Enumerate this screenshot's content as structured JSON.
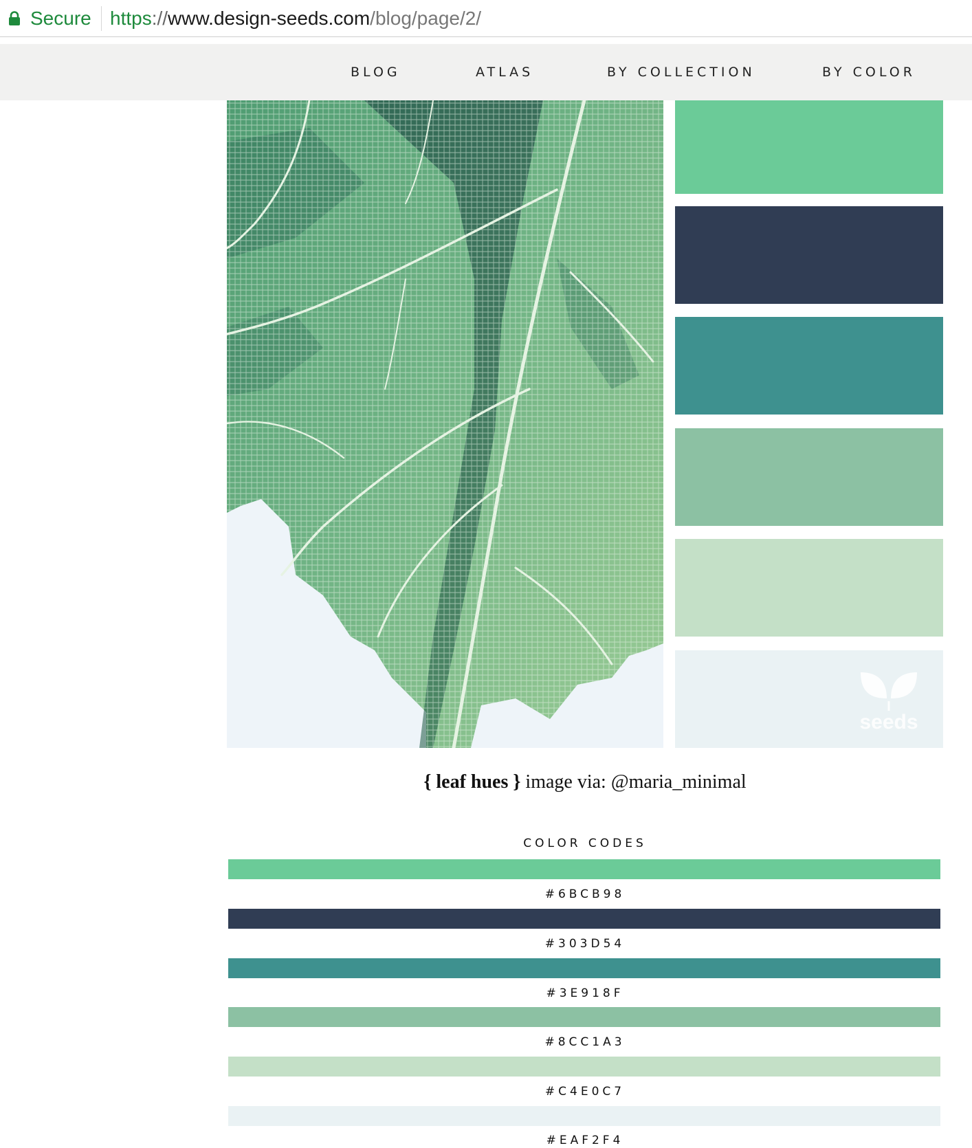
{
  "browser": {
    "secure_label": "Secure",
    "url_scheme": "https",
    "url_sep": "://",
    "url_host": "www.design-seeds.com",
    "url_path": "/blog/page/2/"
  },
  "nav": {
    "items": [
      "BLOG",
      "ATLAS",
      "BY COLLECTION",
      "BY COLOR"
    ]
  },
  "palette": {
    "swatches": [
      "#6BCB98",
      "#303D54",
      "#3E918F",
      "#8CC1A3",
      "#C4E0C7",
      "#EAF2F4"
    ],
    "logo_text": "seeds"
  },
  "caption": {
    "open": "{ ",
    "title": "leaf hues",
    "close": " }",
    "credit": " image via: @maria_minimal"
  },
  "color_codes": {
    "heading": "COLOR CODES",
    "codes": [
      "#6BCB98",
      "#303D54",
      "#3E918F",
      "#8CC1A3",
      "#C4E0C7",
      "#EAF2F4"
    ]
  }
}
